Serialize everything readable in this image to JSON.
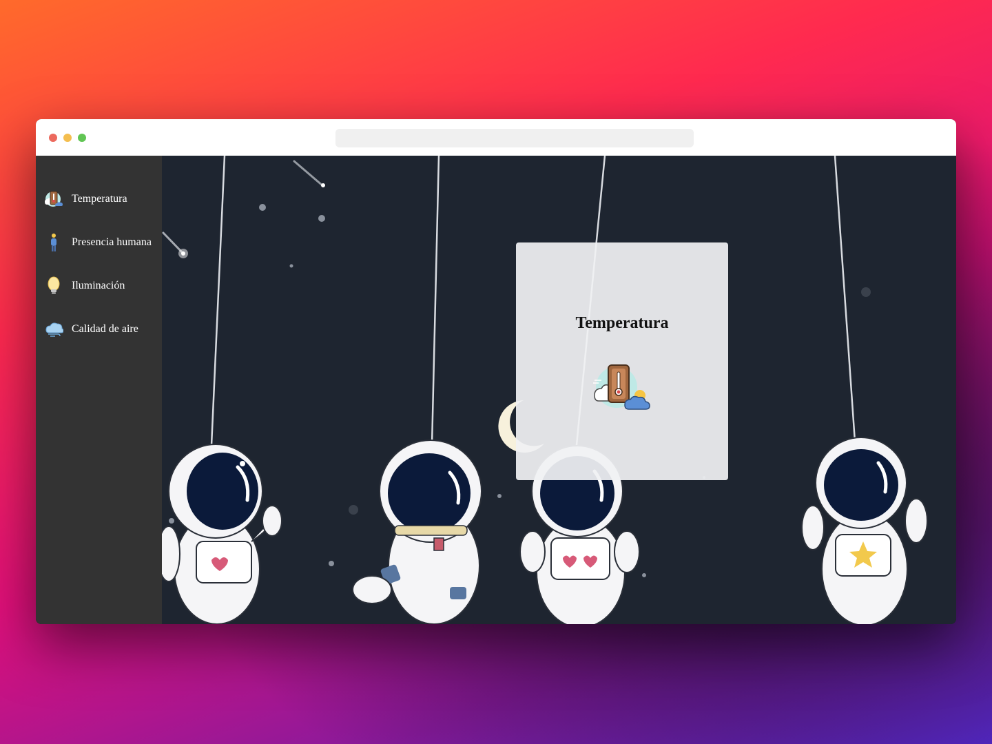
{
  "sidebar": {
    "items": [
      {
        "label": "Temperatura",
        "icon": "thermometer-weather-icon"
      },
      {
        "label": "Presencia humana",
        "icon": "person-icon"
      },
      {
        "label": "Iluminación",
        "icon": "light-bulb-icon"
      },
      {
        "label": "Calidad de aire",
        "icon": "wind-cloud-icon"
      }
    ]
  },
  "main": {
    "card": {
      "title": "Temperatura",
      "icon": "thermometer-weather-icon"
    }
  },
  "colors": {
    "sidebar_bg": "#333333",
    "scene_bg": "#1e2530",
    "card_bg": "#f0f1f3"
  }
}
